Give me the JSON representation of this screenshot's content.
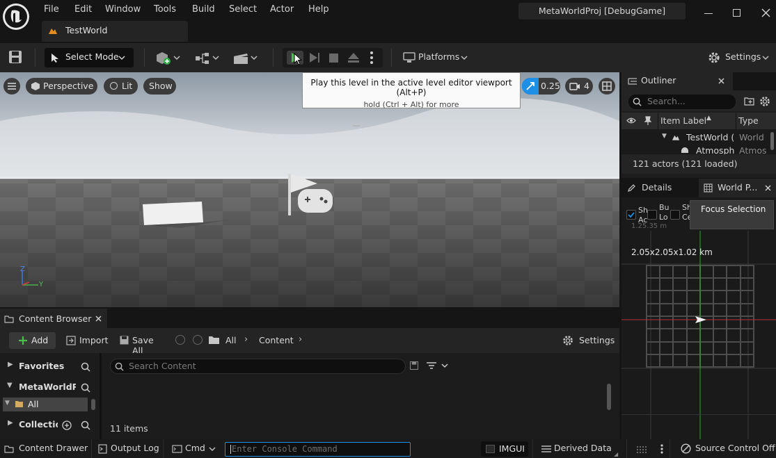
{
  "app": {
    "menu": [
      "File",
      "Edit",
      "Window",
      "Tools",
      "Build",
      "Select",
      "Actor",
      "Help"
    ],
    "project_title": "MetaWorldProj [DebugGame]",
    "doc_tab": "TestWorld"
  },
  "toolbar": {
    "select_mode": "Select Mode",
    "platforms": "Platforms",
    "settings": "Settings"
  },
  "tooltip": {
    "main": "Play this level in the active level editor viewport (Alt+P)",
    "sub": "hold (Ctrl + Alt) for more"
  },
  "viewport": {
    "perspective": "Perspective",
    "lit": "Lit",
    "show": "Show",
    "scale_value": "0.25",
    "camera_speed": "4",
    "axis_z": "Z",
    "axis_y": "Y"
  },
  "outliner": {
    "title": "Outliner",
    "search_placeholder": "Search...",
    "col_label": "Item Label",
    "col_type": "Type",
    "rows": [
      {
        "label": "TestWorld (E",
        "type": "World"
      },
      {
        "label": "Atmosphe",
        "type": "Atmos"
      }
    ],
    "status": "121 actors (121 loaded)"
  },
  "details": {
    "tab_details": "Details",
    "tab_world": "World P...",
    "focus_selection": "Focus Selection",
    "checkbox_labels": [
      "Sh",
      "Bu",
      "Sh"
    ],
    "checkbox_sub": [
      "Ac",
      "Lo",
      "Ce"
    ],
    "size_text": "2.05x2.05x1.02 km",
    "faded_value": "1.25.35 m"
  },
  "content_browser": {
    "title": "Content Browser",
    "add": "Add",
    "import": "Import",
    "save_all": "Save All",
    "crumb_all": "All",
    "crumb_content": "Content",
    "settings": "Settings",
    "favorites": "Favorites",
    "project": "MetaWorldPro",
    "all": "All",
    "collections": "Collection",
    "search_placeholder": "Search Content",
    "items_count": "11 items"
  },
  "statusbar": {
    "content_drawer": "Content Drawer",
    "output_log": "Output Log",
    "cmd": "Cmd",
    "console_placeholder": "Enter Console Command",
    "imgui": "IMGUI",
    "derived_data": "Derived Data",
    "source_control": "Source Control Off"
  },
  "colors": {
    "accent_blue": "#1e8fe6",
    "play_green": "#4bbf4b",
    "panel_bg": "#242424"
  }
}
